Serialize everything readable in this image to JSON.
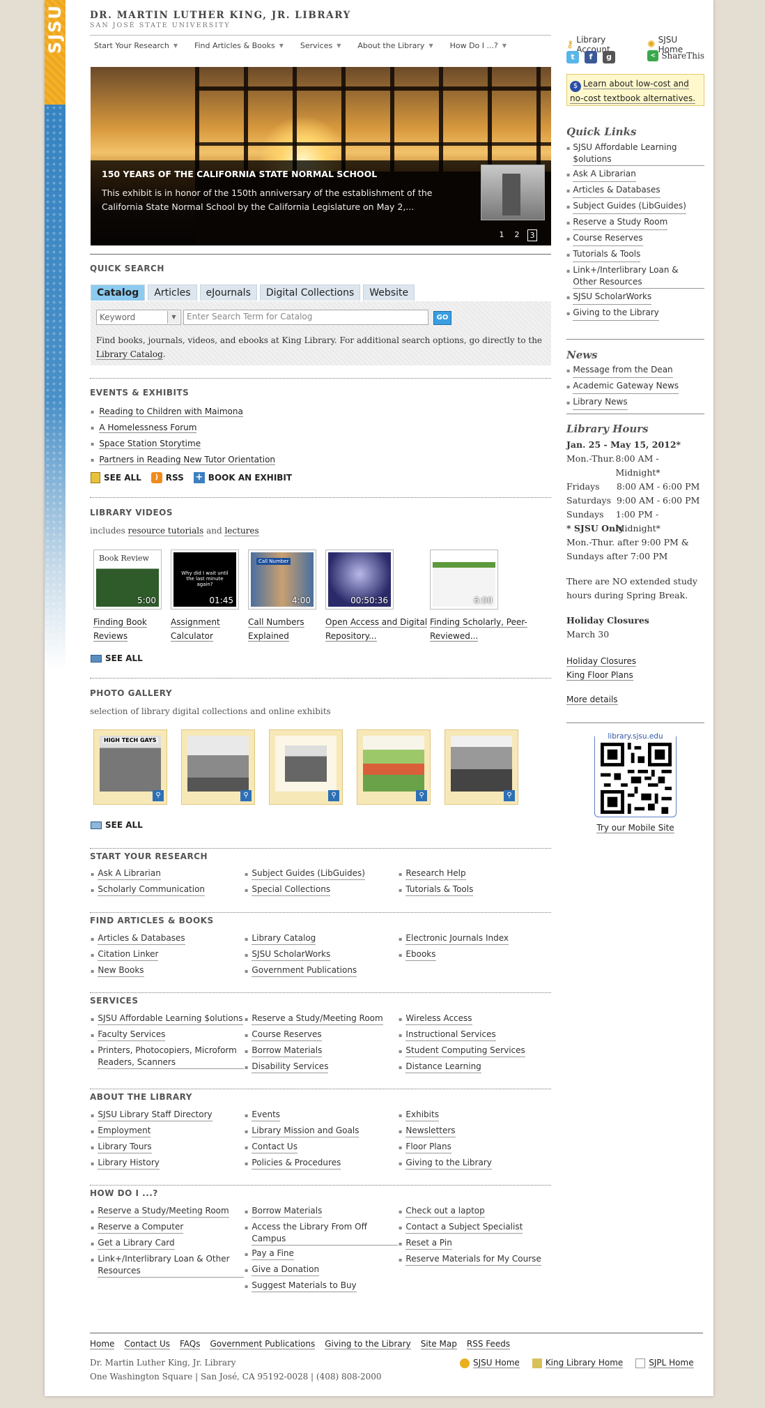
{
  "header": {
    "library_name": "DR. MARTIN LUTHER KING, JR. LIBRARY",
    "university": "SAN JOSÉ STATE UNIVERSITY",
    "sjsu_logo_text": "SJSU"
  },
  "nav": [
    "Start Your Research",
    "Find Articles & Books",
    "Services",
    "About the Library",
    "How Do I ...?"
  ],
  "hero": {
    "title": "150 YEARS OF THE CALIFORNIA STATE NORMAL SCHOOL",
    "text": "This exhibit is in honor of the 150th anniversary of the establishment of the California State Normal School by the California Legislature on May 2,...",
    "pages": [
      "1",
      "2",
      "3"
    ],
    "active_page": 3
  },
  "quick_search": {
    "title": "QUICK SEARCH",
    "tabs": [
      "Catalog",
      "Articles",
      "eJournals",
      "Digital Collections",
      "Website"
    ],
    "active_tab": "Catalog",
    "search_by": "Keyword",
    "placeholder": "Enter Search Term for Catalog",
    "go_label": "GO",
    "desc_prefix": "Find books, journals, videos, and ebooks at King Library. For additional search options, go directly to the ",
    "desc_link": "Library Catalog",
    "desc_suffix": "."
  },
  "events": {
    "title": "EVENTS & EXHIBITS",
    "items": [
      "Reading to Children with Maimona",
      "A Homelessness Forum",
      "Space Station Storytime",
      "Partners in Reading New Tutor Orientation"
    ],
    "see_all": "SEE ALL",
    "rss": "RSS",
    "book_exhibit": "BOOK AN EXHIBIT"
  },
  "videos": {
    "title": "LIBRARY VIDEOS",
    "intro_prefix": "includes ",
    "intro_link1": "resource tutorials",
    "intro_mid": " and ",
    "intro_link2": "lectures",
    "items": [
      {
        "label": "Finding Book Reviews",
        "duration": "5:00",
        "thumb_text": "Book Review"
      },
      {
        "label": "Assignment Calculator",
        "duration": "01:45",
        "thumb_text": "Why did I wait until the last minute again?"
      },
      {
        "label": "Call Numbers Explained",
        "duration": "4:00",
        "thumb_text": "Call Number"
      },
      {
        "label": "Open Access and Digital Repository...",
        "duration": "00:50:36",
        "thumb_text": ""
      },
      {
        "label": "Finding Scholarly, Peer-Reviewed...",
        "duration": "6:00",
        "thumb_text": ""
      }
    ],
    "see_all": "SEE ALL"
  },
  "gallery": {
    "title": "PHOTO GALLERY",
    "intro": "selection of library digital collections and online exhibits",
    "first_photo_text": "HIGH TECH GAYS",
    "see_all": "SEE ALL"
  },
  "start_research": {
    "title": "START YOUR RESEARCH",
    "cols": [
      [
        "Ask A Librarian",
        "Scholarly Communication"
      ],
      [
        "Subject Guides (LibGuides)",
        "Special Collections"
      ],
      [
        "Research Help",
        "Tutorials & Tools"
      ]
    ]
  },
  "find_articles": {
    "title": "FIND ARTICLES & BOOKS",
    "cols": [
      [
        "Articles & Databases",
        "Citation Linker",
        "New Books"
      ],
      [
        "Library Catalog",
        "SJSU ScholarWorks",
        "Government Publications"
      ],
      [
        "Electronic Journals Index",
        "Ebooks"
      ]
    ]
  },
  "services": {
    "title": "SERVICES",
    "cols": [
      [
        "SJSU Affordable Learning $olutions",
        "Faculty Services",
        "Printers, Photocopiers, Microform Readers, Scanners"
      ],
      [
        "Reserve a Study/Meeting Room",
        "Course Reserves",
        "Borrow Materials",
        "Disability Services"
      ],
      [
        "Wireless Access",
        "Instructional Services",
        "Student Computing Services",
        "Distance Learning"
      ]
    ]
  },
  "about": {
    "title": "ABOUT THE LIBRARY",
    "cols": [
      [
        "SJSU Library Staff Directory",
        "Employment",
        "Library Tours",
        "Library History"
      ],
      [
        "Events",
        "Library Mission and Goals",
        "Contact Us",
        "Policies & Procedures"
      ],
      [
        "Exhibits",
        "Newsletters",
        "Floor Plans",
        "Giving to the Library"
      ]
    ]
  },
  "howdoi": {
    "title": "HOW DO I ...?",
    "cols": [
      [
        "Reserve a Study/Meeting Room",
        "Reserve a Computer",
        "Get a Library Card",
        "Link+/Interlibrary Loan & Other Resources"
      ],
      [
        "Borrow Materials",
        "Access the Library From Off Campus",
        "Pay a Fine",
        "Give a Donation",
        "Suggest Materials to Buy"
      ],
      [
        "Check out a laptop",
        "Contact a Subject Specialist",
        "Reset a Pin",
        "Reserve Materials for My Course"
      ]
    ]
  },
  "footer": {
    "links": [
      "Home",
      "Contact Us",
      "FAQs",
      "Government Publications",
      "Giving to the Library",
      "Site Map",
      "RSS Feeds"
    ],
    "address_line1": "Dr. Martin Luther King, Jr. Library",
    "address_line2": "One Washington Square",
    "address_line3": "San José, CA 95192-0028",
    "phone": "(408) 808-2000",
    "homes": [
      "SJSU Home",
      "King Library Home",
      "SJPL Home"
    ]
  },
  "sidebar": {
    "account": "Library Account",
    "sjsu_home": "SJSU Home",
    "share": "ShareThis",
    "notice": "Learn about low-cost and no-cost textbook alternatives.",
    "quick_links_title": "Quick Links",
    "quick_links": [
      "SJSU Affordable Learning $olutions",
      "Ask A Librarian",
      "Articles & Databases",
      "Subject Guides (LibGuides)",
      "Reserve a Study Room",
      "Course Reserves",
      "Tutorials & Tools",
      "Link+/Interlibrary Loan & Other Resources",
      "SJSU ScholarWorks",
      "Giving to the Library"
    ],
    "news_title": "News",
    "news": [
      "Message from the Dean",
      "Academic Gateway News",
      "Library News"
    ],
    "hours_title": "Library Hours",
    "hours_range": "Jan. 25 - May 15, 2012*",
    "hours": [
      {
        "day": "Mon.-Thur.",
        "time": "8:00 AM - Midnight*"
      },
      {
        "day": "Fridays",
        "time": "8:00 AM - 6:00 PM"
      },
      {
        "day": "Saturdays",
        "time": "9:00 AM - 6:00 PM"
      },
      {
        "day": "Sundays",
        "time": "1:00 PM - Midnight*"
      }
    ],
    "sjsu_only_title": "* SJSU Only",
    "sjsu_only_text": "Mon.-Thur. after 9:00 PM & Sundays after 7:00 PM",
    "no_extended": "There are NO extended study hours during Spring Break.",
    "closures_title": "Holiday Closures",
    "closures_date": "March 30",
    "closures_link": "Holiday Closures",
    "floor_plans": "King Floor Plans",
    "more_details": "More details",
    "mobile_url": "library.sjsu.edu",
    "mobile_link": "Try our Mobile Site"
  }
}
